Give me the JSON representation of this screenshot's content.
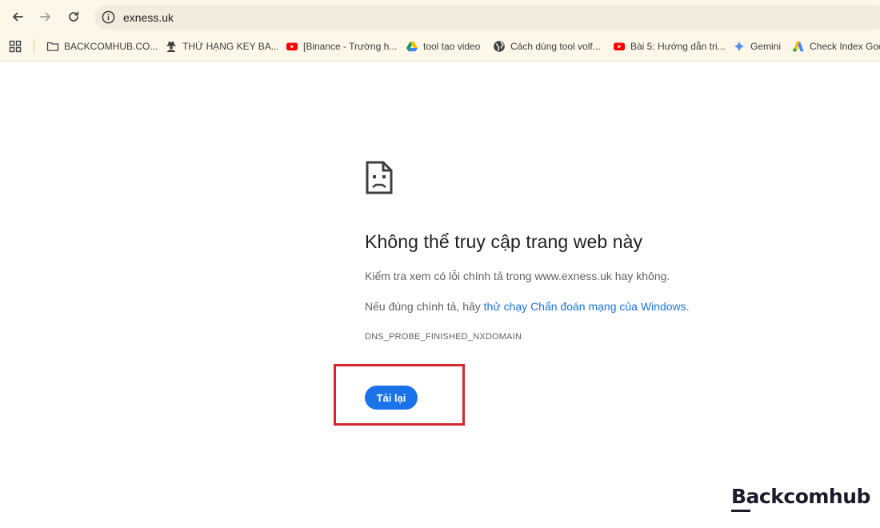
{
  "browser": {
    "url": "exness.uk",
    "bookmarks": [
      {
        "label": "BACKCOMHUB.CO...",
        "icon": "folder-icon"
      },
      {
        "label": "THỨ HẠNG KEY BA...",
        "icon": "spy-icon"
      },
      {
        "label": "[Binance - Trường h...",
        "icon": "youtube-icon"
      },
      {
        "label": "tool tạo video",
        "icon": "drive-icon"
      },
      {
        "label": "Cách dùng tool volf...",
        "icon": "globe-icon"
      },
      {
        "label": "Bài 5: Hướng dẫn tri...",
        "icon": "youtube-icon"
      },
      {
        "label": "Gemini",
        "icon": "gemini-icon"
      },
      {
        "label": "Check Index Goo",
        "icon": "ads-icon"
      }
    ]
  },
  "error": {
    "title": "Không thể truy cập trang web này",
    "line1": "Kiểm tra xem có lỗi chính tả trong www.exness.uk hay không.",
    "line2_prefix": "Nếu đúng chính tả, hãy ",
    "line2_link": "thử chạy Chẩn đoán mạng của Windows",
    "line2_suffix": ".",
    "code": "DNS_PROBE_FINISHED_NXDOMAIN",
    "reload_label": "Tải lại"
  },
  "watermark": {
    "brand": "Backcomhub"
  },
  "colors": {
    "accent": "#1a73e8",
    "highlight": "#d7262e",
    "toolbar": "#fdf7e9"
  }
}
